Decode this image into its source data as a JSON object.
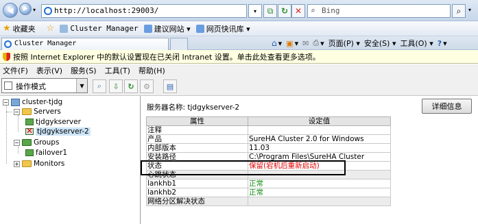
{
  "browser": {
    "url": "http://localhost:29003/",
    "search_placeholder": "Bing",
    "favorites_label": "收藏夹",
    "favorites": [
      {
        "label": "Cluster Manager"
      },
      {
        "label": "建议网站 ▾"
      },
      {
        "label": "网页快讯库 ▾"
      }
    ],
    "tab_title": "Cluster Manager",
    "commands": {
      "page": "页面(P) ▾",
      "safety": "安全(S) ▾",
      "tools": "工具(O) ▾"
    },
    "info_bar": "按照 Internet Explorer 中的默认设置现在已关闭 Intranet 设置。单击此处查看更多选项。"
  },
  "app": {
    "menu": [
      "文件(F)",
      "表示(V)",
      "服务(S)",
      "工具(T)",
      "帮助(H)"
    ],
    "mode": "操作模式",
    "tree": {
      "root": "cluster-tjdg",
      "servers": "Servers",
      "server1": "tjdgykserver",
      "server2": "tjdgykserver-2",
      "groups": "Groups",
      "group1": "failover1",
      "monitors": "Monitors"
    },
    "server_name_label": "服务器名称: tjdgykserver-2",
    "detail_button": "详细信息",
    "table": {
      "headers": [
        "属性",
        "设定值"
      ],
      "rows": [
        {
          "prop": "注释",
          "value": "",
          "type": "normal"
        },
        {
          "prop": "产品",
          "value": "SureHA Cluster 2.0 for Windows",
          "type": "normal"
        },
        {
          "prop": "内部版本",
          "value": "11.03",
          "type": "normal"
        },
        {
          "prop": "安装路径",
          "value": "C:\\Program Files\\SureHA Cluster",
          "type": "normal"
        },
        {
          "prop": "状态",
          "value": "保留(宕机后重新启动)",
          "type": "red"
        },
        {
          "prop": "心跳状态",
          "value": "",
          "type": "group"
        },
        {
          "prop": "lankhb1",
          "value": "正常",
          "type": "green"
        },
        {
          "prop": "lankhb2",
          "value": "正常",
          "type": "green"
        },
        {
          "prop": "网络分区解决状态",
          "value": "",
          "type": "group"
        }
      ]
    }
  }
}
